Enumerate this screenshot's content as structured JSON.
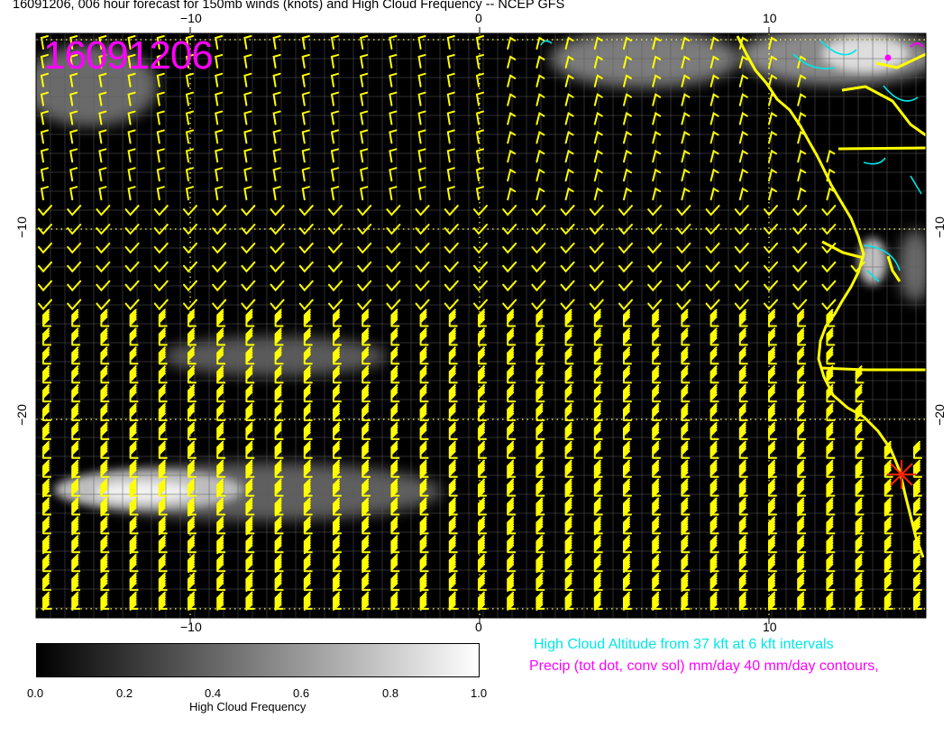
{
  "title": "16091206, 006 hour forecast for 150mb winds (knots) and High Cloud Frequency -- NCEP GFS",
  "stamp": "16091206",
  "axes": {
    "x_ticks": [
      "−10",
      "0",
      "10"
    ],
    "y_ticks": [
      "−10",
      "−20"
    ]
  },
  "colorbar": {
    "label": "High Cloud Frequency",
    "ticks": [
      "0.0",
      "0.2",
      "0.4",
      "0.6",
      "0.8",
      "1.0"
    ],
    "range": [
      0.0,
      1.0
    ]
  },
  "notes": {
    "cloud_altitude": "High Cloud Altitude from 37 kft at 6 kft intervals",
    "precip": "Precip (tot dot, conv sol) mm/day 40 mm/day contours,"
  },
  "colors": {
    "background": "#000000",
    "barbs": "#ffff00",
    "coastline": "#ffff00",
    "cloud_contour": "#00e6e6",
    "precip": "#ff00ff",
    "marker": "#ff2200",
    "graticule": "#ffff66"
  },
  "icons": {
    "station_marker": "asterisk-icon",
    "wind_symbol": "wind-barb-icon"
  }
}
